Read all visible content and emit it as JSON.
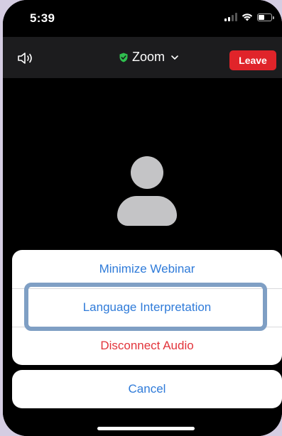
{
  "status_bar": {
    "time": "5:39"
  },
  "header": {
    "meeting_title": "Zoom",
    "leave_label": "Leave",
    "icons": {
      "speaker": "speaker-icon",
      "shield": "shield-check-icon",
      "dropdown": "chevron-down-icon"
    }
  },
  "action_sheet": {
    "items": [
      {
        "label": "Minimize Webinar",
        "style": "default"
      },
      {
        "label": "Language Interpretation",
        "style": "default",
        "highlighted": true
      },
      {
        "label": "Disconnect Audio",
        "style": "destructive"
      }
    ],
    "cancel_label": "Cancel"
  },
  "colors": {
    "leave_button": "#e0242a",
    "action_text": "#2f7bd9",
    "destructive_text": "#e2343b",
    "highlight_frame": "#7f9fc4",
    "shield_green": "#2fbf4f"
  }
}
